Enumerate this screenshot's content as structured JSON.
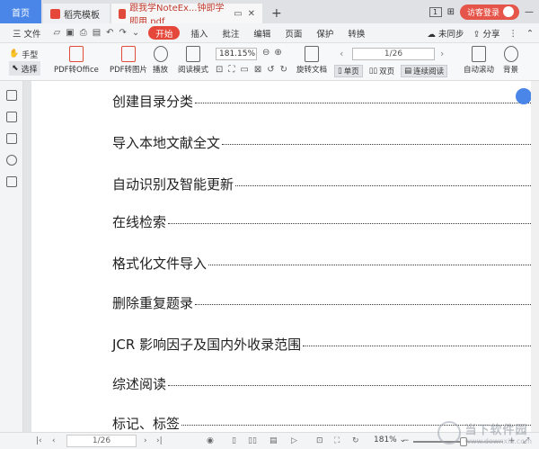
{
  "tabs": {
    "home": "首页",
    "template": "稻壳模板",
    "document": "跟我学NoteEx...钟即学即用.pdf",
    "add": "+"
  },
  "titlebar": {
    "badge": "1",
    "login": "访客登录"
  },
  "menu": {
    "file": "三 文件",
    "items": [
      "开始",
      "插入",
      "批注",
      "编辑",
      "页面",
      "保护",
      "转换"
    ],
    "right": [
      "未同步",
      "分享"
    ]
  },
  "toolbar": {
    "hand": "手型",
    "select": "选择",
    "pdf_to_office": "PDF转Office",
    "pdf_to_image": "PDF转图片",
    "play": "播放",
    "read_mode": "阅读模式",
    "zoom_value": "181.15%",
    "rotate": "旋转文档",
    "page_value": "1/26",
    "single": "单页",
    "double": "双页",
    "continuous": "连续阅读",
    "auto_scroll": "自动滚动",
    "background": "背景"
  },
  "toc": [
    "创建目录分类",
    "导入本地文献全文",
    "自动识别及智能更新",
    "在线检索",
    "格式化文件导入",
    "删除重复题录",
    "JCR 影响因子及国内外收录范围",
    "综述阅读",
    "标记、标签"
  ],
  "statusbar": {
    "page": "1/26",
    "zoom": "181%"
  },
  "watermark": {
    "title": "当下软件园",
    "url": "www.downxia.com"
  },
  "colors": {
    "accent": "#4a86e8",
    "brand_red": "#e5483b"
  }
}
